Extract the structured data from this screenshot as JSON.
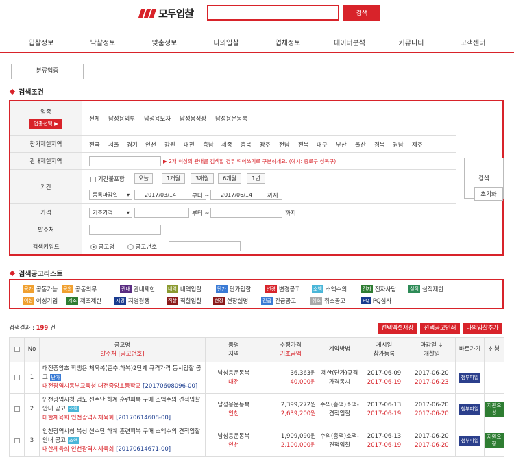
{
  "header": {
    "logo_text": "모두입찰",
    "search_button": "검색"
  },
  "gnb": [
    "입찰정보",
    "낙찰정보",
    "맞춤정보",
    "나의입찰",
    "업체정보",
    "데이터분석",
    "커뮤니티",
    "고객센터"
  ],
  "tab": "분류업종",
  "search_section_title": "검색조건",
  "conditions": {
    "industry_label": "업종",
    "industry_select_button": "업종선택 ▶",
    "industry_items": [
      "전체",
      "남성용외투",
      "남성용모자",
      "남성용정장",
      "남성용운동복"
    ],
    "region_label": "참가제한지역",
    "regions": [
      "전국",
      "서울",
      "경기",
      "인천",
      "강원",
      "대전",
      "충남",
      "세종",
      "충북",
      "광주",
      "전남",
      "전북",
      "대구",
      "부산",
      "울산",
      "경북",
      "경남",
      "제주"
    ],
    "jurisdiction_label": "관내제한지역",
    "jurisdiction_note": "▶ 2개 이상의 관내를 검색할 경우 띄어쓰기로 구분하세요. (예시: 종로구 성북구)",
    "period_label": "기간",
    "period_unlimited": "기간불포함",
    "period_buttons": [
      "오늘",
      "1개월",
      "3개월",
      "6개월",
      "1년"
    ],
    "period_select": "등록마감일",
    "period_from": "2017/03/14",
    "period_to": "2017/06/14",
    "from_label": "부터 ~",
    "to_label": "까지",
    "price_label": "가격",
    "price_select": "기초가격",
    "buyer_label": "발주처",
    "keyword_label": "검색키워드",
    "keyword_options": [
      "공고명",
      "공고번호"
    ],
    "search_button": "검색",
    "reset_button": "초기화"
  },
  "list_section_title": "검색공고리스트",
  "legend": [
    {
      "badge": "공가",
      "label": "공동가능",
      "color": "#f0a030"
    },
    {
      "badge": "공의",
      "label": "공동의무",
      "color": "#f0a030"
    },
    {
      "badge": "관내",
      "label": "관내제한",
      "color": "#5a2d82"
    },
    {
      "badge": "내역",
      "label": "내역입찰",
      "color": "#8a9a30"
    },
    {
      "badge": "단가",
      "label": "단가입찰",
      "color": "#3a7bd5"
    },
    {
      "badge": "변경",
      "label": "변경공고",
      "color": "#d8232a"
    },
    {
      "badge": "소액",
      "label": "소액수의",
      "color": "#4ab6d8"
    },
    {
      "badge": "전자",
      "label": "전자사담",
      "color": "#2e7d32"
    },
    {
      "badge": "실적",
      "label": "실적제한",
      "color": "#2e8b57"
    },
    {
      "badge": "여성",
      "label": "여성기업",
      "color": "#f0a030"
    },
    {
      "badge": "제조",
      "label": "제조제한",
      "color": "#2e7d32"
    },
    {
      "badge": "지명",
      "label": "지명경쟁",
      "color": "#1a3c8f"
    },
    {
      "badge": "직찰",
      "label": "직찰입찰",
      "color": "#8b1a1a"
    },
    {
      "badge": "현장",
      "label": "현장설명",
      "color": "#8b1a1a"
    },
    {
      "badge": "긴급",
      "label": "긴급공고",
      "color": "#3a7bd5"
    },
    {
      "badge": "취소",
      "label": "취소공고",
      "color": "#aaaaaa"
    },
    {
      "badge": "PQ",
      "label": "PQ심사",
      "color": "#1a3c8f"
    }
  ],
  "results": {
    "label_prefix": "검색결과 : ",
    "count": "199",
    "label_suffix": " 건",
    "buttons": [
      "선택엑셀저장",
      "선택공고인쇄",
      "나의입찰추가"
    ]
  },
  "table": {
    "headers": {
      "no": "No",
      "title": "공고명",
      "title_sub": "발주처 [공고번호]",
      "item": "품명",
      "item_sub": "지역",
      "price": "추정가격",
      "price_sub": "기초금액",
      "contract": "계약방법",
      "posted": "게시일",
      "posted_sub": "참가등록",
      "deadline": "마감일 ↓",
      "deadline_sub": "개찰일",
      "shortcut": "바로가기",
      "apply": "신청"
    },
    "rows": [
      {
        "no": "1",
        "title": "대전중앙초 학생용 체육복(춘추,하복)2단계 규격가격 동시입찰 공고",
        "badge": "단가",
        "badge_color": "#3a7bd5",
        "buyer": "대전광역시동부교육청 대전중앙초등학교",
        "notice_no": "[20170608096-00]",
        "item": "남성용운동복",
        "region": "대전",
        "est_price": "36,363원",
        "base_price": "40,000원",
        "contract": "제한(단가)규격가격동시",
        "posted": "2017-06-09",
        "register": "2017-06-19",
        "deadline": "2017-06-20",
        "opening": "2017-06-23",
        "download": "첨부파일",
        "apply": ""
      },
      {
        "no": "2",
        "title": "인천광역시청 검도 선수단 하계 훈련피복 구매 소액수의 견적입찰 안내 공고",
        "badge": "소액",
        "badge_color": "#4ab6d8",
        "buyer": "대한체육회 인천광역시체육회",
        "notice_no": "[20170614608-00]",
        "item": "남성용운동복",
        "region": "인천",
        "est_price": "2,399,272원",
        "base_price": "2,639,200원",
        "contract": "수의(총액)소액-견적입찰",
        "posted": "2017-06-13",
        "register": "2017-06-19",
        "deadline": "2017-06-20",
        "opening": "2017-06-20",
        "download": "첨부파일",
        "apply": "지원요청"
      },
      {
        "no": "3",
        "title": "인천광역시청 복싱 선수단 하계 훈련피복 구매 소액수의 견적입찰 안내 공고",
        "badge": "소액",
        "badge_color": "#4ab6d8",
        "buyer": "대한체육회 인천광역시체육회",
        "notice_no": "[20170614671-00]",
        "item": "남성용운동복",
        "region": "인천",
        "est_price": "1,909,090원",
        "base_price": "2,100,000원",
        "contract": "수의(총액)소액-견적입찰",
        "posted": "2017-06-13",
        "register": "2017-06-19",
        "deadline": "2017-06-20",
        "opening": "2017-06-20",
        "download": "첨부파일",
        "apply": "지원요청"
      }
    ]
  }
}
